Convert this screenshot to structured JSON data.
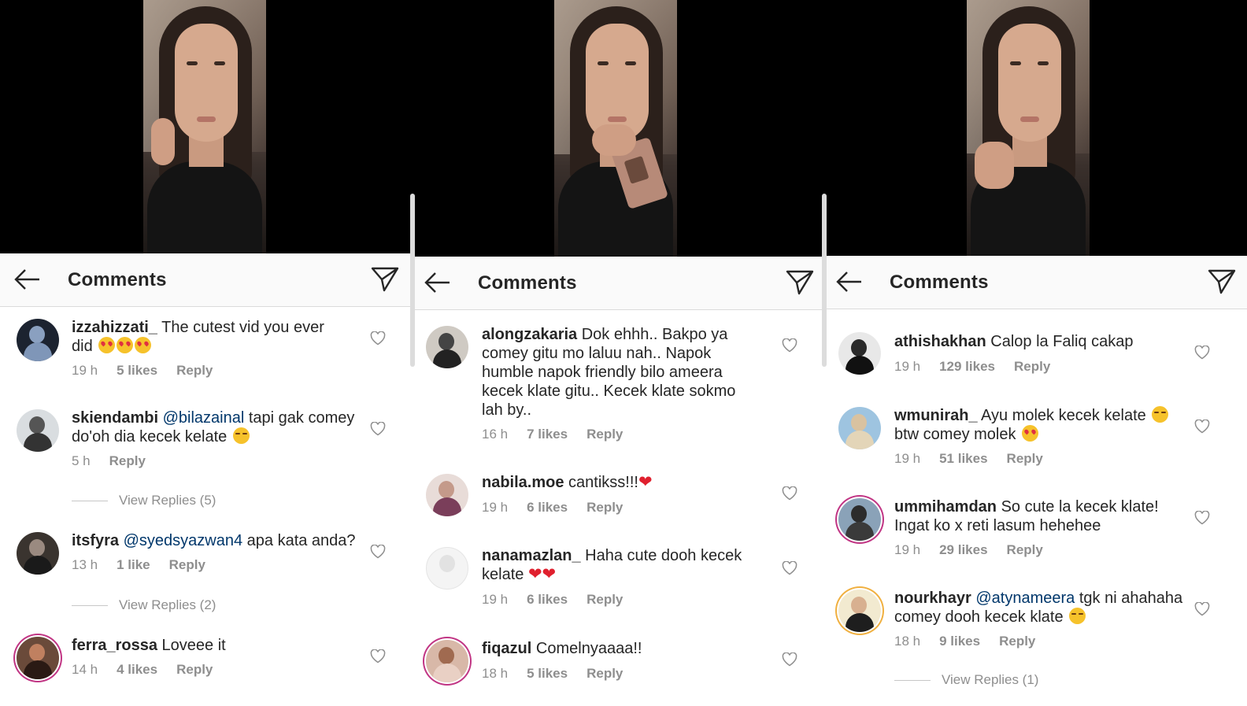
{
  "panels": [
    {
      "title": "Comments",
      "comments": [
        {
          "user": "izzahizzati_",
          "text": "The cutest vid you ever did",
          "emoji": "😍😍😍",
          "time": "19 h",
          "likes": "5 likes",
          "reply": "Reply"
        },
        {
          "user": "skiendambi",
          "mention": "@bilazainal",
          "text": "tapi gak comey do'oh dia kecek kelate",
          "emoji": "😅",
          "time": "5 h",
          "likes": "",
          "reply": "Reply",
          "view_replies": "View Replies (5)"
        },
        {
          "user": "itsfyra",
          "mention": "@syedsyazwan4",
          "text": "apa kata anda?",
          "time": "13 h",
          "likes": "1 like",
          "reply": "Reply",
          "view_replies": "View Replies (2)"
        },
        {
          "user": "ferra_rossa",
          "text": "Loveee it",
          "time": "14 h",
          "likes": "4 likes",
          "reply": "Reply"
        }
      ]
    },
    {
      "title": "Comments",
      "comments": [
        {
          "user": "alongzakaria",
          "text": "Dok ehhh.. Bakpo ya comey gitu mo laluu nah.. Napok humble napok friendly bilo ameera kecek klate gitu.. Kecek klate sokmo lah by..",
          "time": "16 h",
          "likes": "7 likes",
          "reply": "Reply"
        },
        {
          "user": "nabila.moe",
          "text": "cantikss!!!",
          "emoji": "❤️",
          "time": "19 h",
          "likes": "6 likes",
          "reply": "Reply"
        },
        {
          "user": "nanamazlan_",
          "text": "Haha cute dooh kecek kelate",
          "emoji": "❤️❤️",
          "time": "19 h",
          "likes": "6 likes",
          "reply": "Reply"
        },
        {
          "user": "fiqazul",
          "text": "Comelnyaaaa!!",
          "time": "18 h",
          "likes": "5 likes",
          "reply": "Reply"
        }
      ]
    },
    {
      "title": "Comments",
      "comments": [
        {
          "user": "athishakhan",
          "text": "Calop la Faliq cakap",
          "time": "19 h",
          "likes": "129 likes",
          "reply": "Reply"
        },
        {
          "user": "wmunirah_",
          "text": "Ayu molek kecek kelate",
          "emoji": "😅",
          "text2": "btw comey molek",
          "emoji2": "😍",
          "time": "19 h",
          "likes": "51 likes",
          "reply": "Reply"
        },
        {
          "user": "ummihamdan",
          "text": "So cute la kecek klate! Ingat ko x reti lasum hehehee",
          "time": "19 h",
          "likes": "29 likes",
          "reply": "Reply"
        },
        {
          "user": "nourkhayr",
          "mention": "@atynameera",
          "text": "tgk ni ahahaha comey dooh kecek klate",
          "emoji": "😜",
          "time": "18 h",
          "likes": "9 likes",
          "reply": "Reply",
          "view_replies": "View Replies (1)"
        }
      ]
    }
  ],
  "icons": {
    "back": "arrow-left-icon",
    "send": "paper-plane-icon",
    "like": "heart-outline-icon",
    "avatar": "user-avatar"
  },
  "colors": {
    "mention": "#00376b",
    "meta": "#8e8e8e",
    "text": "#262626",
    "header_bg": "#fafafa",
    "video_bg": "#000000"
  }
}
